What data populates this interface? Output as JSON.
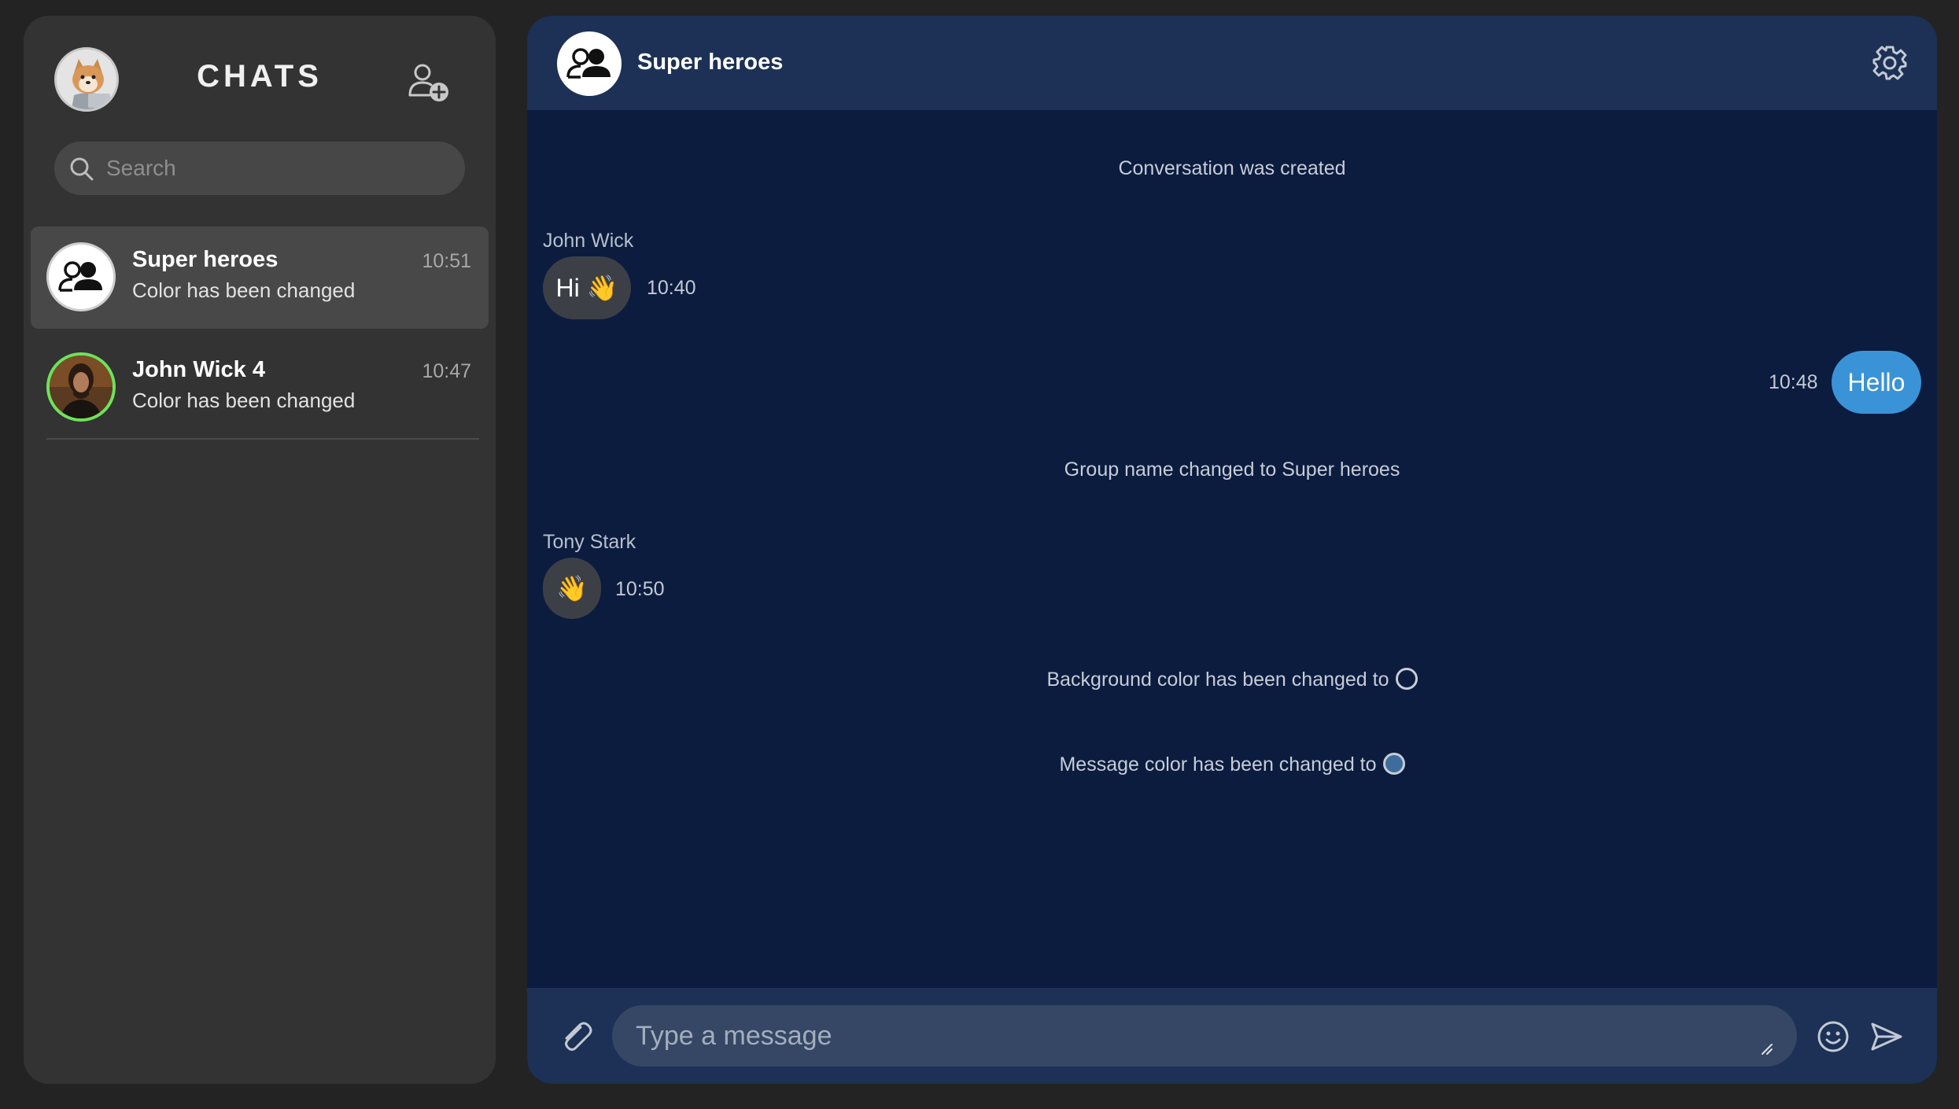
{
  "sidebar": {
    "title": "CHATS",
    "search": {
      "placeholder": "Search",
      "value": ""
    },
    "chats": [
      {
        "name": "Super heroes",
        "last_message": "Color has been changed",
        "time": "10:51",
        "active": true,
        "avatar": "group-icon"
      },
      {
        "name": "John Wick 4",
        "last_message": "Color has been changed",
        "time": "10:47",
        "active": false,
        "avatar": "photo"
      }
    ]
  },
  "chat": {
    "title": "Super heroes",
    "messages": [
      {
        "type": "system",
        "text": "Conversation was created"
      },
      {
        "type": "incoming",
        "sender": "John Wick",
        "text": "Hi 👋",
        "time": "10:40"
      },
      {
        "type": "outgoing",
        "text": "Hello",
        "time": "10:48"
      },
      {
        "type": "system",
        "text": "Group name changed to Super heroes"
      },
      {
        "type": "incoming",
        "sender": "Tony Stark",
        "text": "👋",
        "time": "10:50"
      },
      {
        "type": "system",
        "text": "Background color has been changed to",
        "color": "#0b1c3f"
      },
      {
        "type": "system",
        "text": "Message color has been changed to",
        "color": "#3c6d9c"
      }
    ]
  },
  "composer": {
    "placeholder": "Type a message",
    "value": ""
  },
  "colors": {
    "sidebar_bg": "#333333",
    "chat_bg": "#0b1c3f",
    "header_bg": "#1c3155",
    "outgoing_bubble": "#3a93d6",
    "incoming_bubble": "#3d3f47",
    "online_ring": "#6de35a"
  }
}
